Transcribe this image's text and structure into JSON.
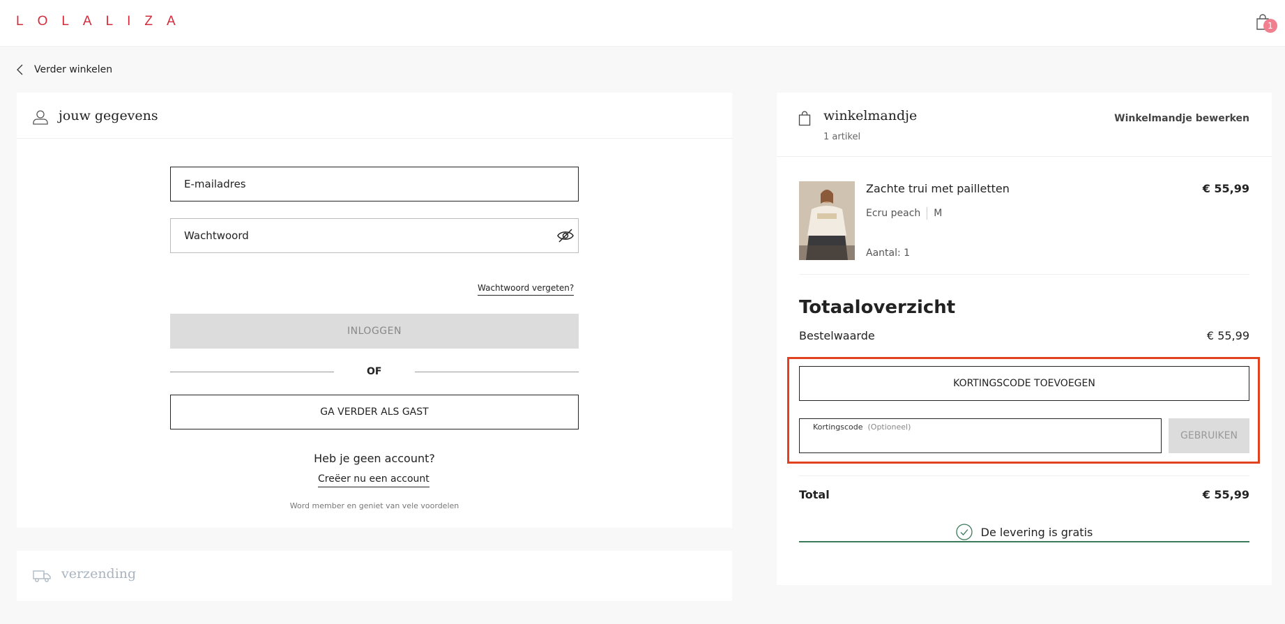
{
  "header": {
    "logo_text": "LOLALIZA",
    "cart_badge": "1",
    "brand_color": "#d42b3c"
  },
  "nav": {
    "back_label": "Verder winkelen"
  },
  "details": {
    "title": "jouw gegevens",
    "email_placeholder": "E-mailadres",
    "password_placeholder": "Wachtwoord",
    "forgot_label": "Wachtwoord vergeten?",
    "login_label": "INLOGGEN",
    "or_label": "OF",
    "guest_label": "GA VERDER ALS GAST",
    "no_account_text": "Heb je geen account?",
    "create_account_label": "Creëer nu een account",
    "member_text": "Word member en geniet van vele voordelen"
  },
  "shipping": {
    "title": "verzending"
  },
  "cart": {
    "title": "winkelmandje",
    "count": "1 artikel",
    "edit_label": "Winkelmandje bewerken",
    "items": [
      {
        "name": "Zachte trui met pailletten",
        "price": "€ 55,99",
        "color": "Ecru peach",
        "size": "M",
        "quantity": "Aantal: 1"
      }
    ]
  },
  "summary": {
    "title": "Totaaloverzicht",
    "order_value_label": "Bestelwaarde",
    "order_value": "€ 55,99",
    "add_code_label": "KORTINGSCODE TOEVOEGEN",
    "code_label": "Kortingscode",
    "code_optional": "(Optioneel)",
    "use_label": "GEBRUIKEN",
    "total_label": "Total",
    "total_value": "€ 55,99",
    "free_delivery": "De levering is gratis",
    "highlight_color": "#e0421e"
  }
}
